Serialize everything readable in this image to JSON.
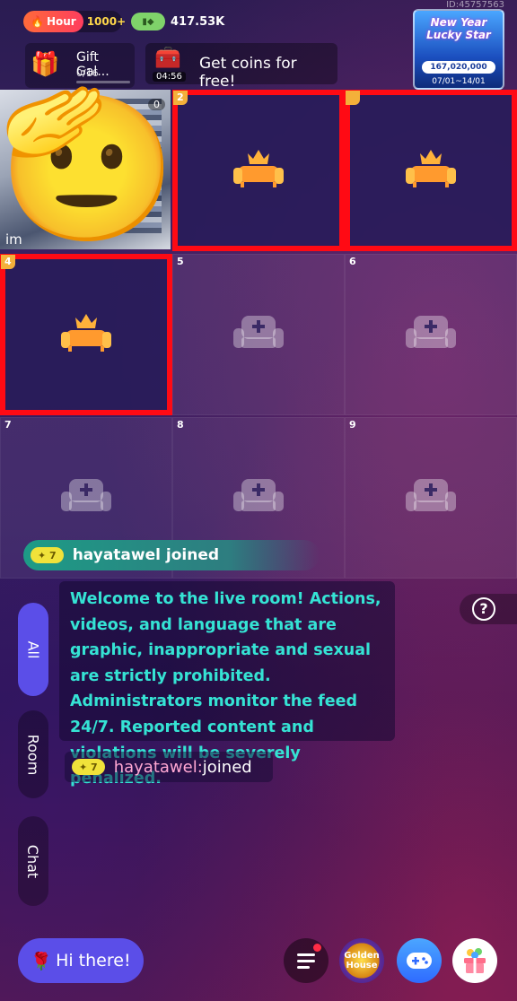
{
  "top_bar": {
    "hour_label": "Hour",
    "hour_value": "1000+",
    "coins_value": "417.53K",
    "room_id": "ID:45757563"
  },
  "gift_gallery": {
    "title": "Gift Gal...",
    "count": "0/16"
  },
  "free_coins": {
    "timer": "04:56",
    "label": "Get coins for free!"
  },
  "event_banner": {
    "title": "New Year Lucky Star",
    "amount": "167,020,000",
    "dates": "07/01~14/01"
  },
  "camera_tile": {
    "name": "im",
    "badge": "0"
  },
  "seats": [
    {
      "number": "2",
      "state": "occupied"
    },
    {
      "number": "",
      "state": "occupied"
    },
    {
      "number": "4",
      "state": "occupied"
    },
    {
      "number": "5",
      "state": "empty"
    },
    {
      "number": "6",
      "state": "empty"
    },
    {
      "number": "7",
      "state": "empty"
    },
    {
      "number": "8",
      "state": "empty"
    },
    {
      "number": "9",
      "state": "empty"
    }
  ],
  "join_banner": {
    "level": "7",
    "text": "hayatawel joined"
  },
  "tabs": {
    "all": "All",
    "room": "Room",
    "chat": "Chat"
  },
  "help": {
    "icon": "question-icon"
  },
  "welcome_message": "Welcome to the live room! Actions, videos, and language that are graphic, inappropriate and sexual are strictly prohibited. Administrators monitor the feed 24/7. Reported content and violations will be severely penalized.",
  "chat_join": {
    "level": "7",
    "user": "hayatawel:",
    "message": " joined"
  },
  "bottom_bar": {
    "hi_label": "Hi there!",
    "golden_label": "Golden House"
  },
  "colors": {
    "accent": "#5b4ee8",
    "welcome_text": "#35e3d4",
    "highlight": "#ff0a14",
    "seat_gold": "#f4b03a"
  }
}
